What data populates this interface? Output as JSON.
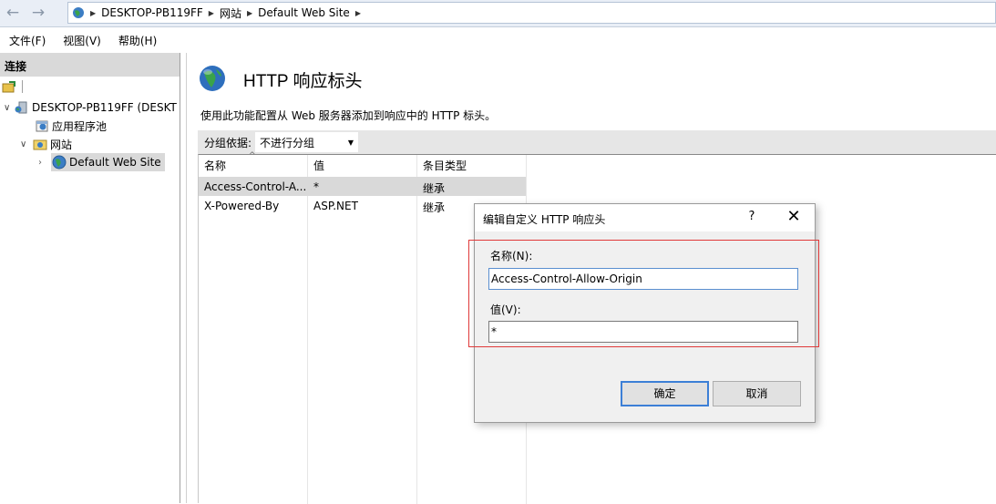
{
  "breadcrumb": [
    "DESKTOP-PB119FF",
    "网站",
    "Default Web Site"
  ],
  "menu": [
    "文件(F)",
    "视图(V)",
    "帮助(H)"
  ],
  "connections": {
    "header": "连接",
    "tree": [
      {
        "label": "DESKTOP-PB119FF (DESKT",
        "icon": "server-icon"
      },
      {
        "label": "应用程序池",
        "icon": "app-pool-icon"
      },
      {
        "label": "网站",
        "icon": "sites-folder-icon"
      },
      {
        "label": "Default Web Site",
        "icon": "globe-icon",
        "selected": true
      }
    ]
  },
  "page": {
    "title": "HTTP 响应标头",
    "description": "使用此功能配置从 Web 服务器添加到响应中的 HTTP 标头。",
    "group_label": "分组依据:",
    "group_value": "不进行分组"
  },
  "grid": {
    "columns": [
      "名称",
      "值",
      "条目类型"
    ],
    "rows": [
      {
        "name": "Access-Control-A...",
        "value": "*",
        "type": "继承",
        "selected": true
      },
      {
        "name": "X-Powered-By",
        "value": "ASP.NET",
        "type": "继承",
        "selected": false
      }
    ]
  },
  "dialog": {
    "title": "编辑自定义 HTTP 响应头",
    "help": "?",
    "close": "✕",
    "name_label": "名称(N):",
    "name_value": "Access-Control-Allow-Origin",
    "value_label": "值(V):",
    "value_value": "*",
    "ok": "确定",
    "cancel": "取消"
  },
  "colors": {
    "selected_row": "#d9d9d9",
    "highlight_box": "#e03a3a",
    "ok_border": "#3c7fd6"
  }
}
